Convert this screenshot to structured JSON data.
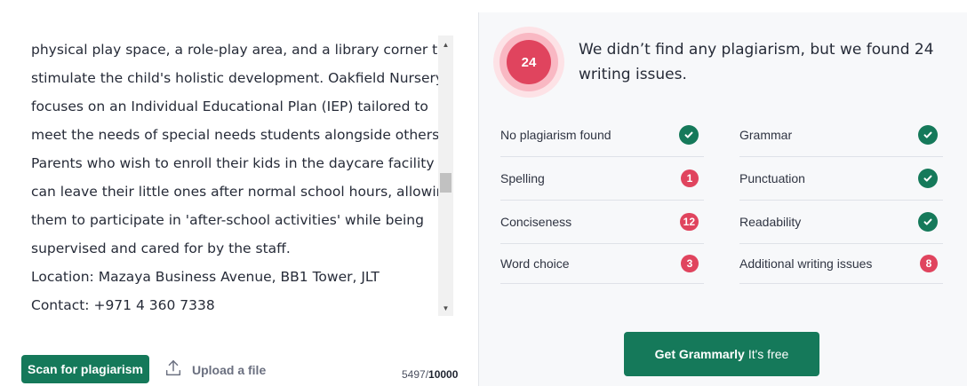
{
  "editor": {
    "lines": [
      "physical play space, a role-play area, and a library corner to",
      "stimulate the child's holistic development. Oakfield Nursery",
      "focuses on an Individual Educational Plan (IEP) tailored to",
      "meet the needs of special needs students alongside others.",
      "Parents who wish to enroll their kids in the daycare facility",
      "can leave their little ones after normal school hours, allowing",
      "them to participate in 'after-school activities' while being",
      "supervised and cared for by the staff.",
      "Location: Mazaya Business Avenue, BB1 Tower, JLT",
      "Contact: +971 4 360 7338"
    ],
    "scroll_up_icon": "▲",
    "scroll_down_icon": "▼"
  },
  "footer": {
    "scan_label": "Scan for plagiarism",
    "upload_label": "Upload a file",
    "char_count": "5497/",
    "char_limit": "10000"
  },
  "results": {
    "score": "24",
    "headline": "We didn’t find any plagiarism, but we found 24 writing issues.",
    "left_checks": [
      {
        "label": "No plagiarism found",
        "status": "ok",
        "count": ""
      },
      {
        "label": "Spelling",
        "status": "issue",
        "count": "1"
      },
      {
        "label": "Conciseness",
        "status": "issue",
        "count": "12"
      },
      {
        "label": "Word choice",
        "status": "issue",
        "count": "3"
      }
    ],
    "right_checks": [
      {
        "label": "Grammar",
        "status": "ok",
        "count": ""
      },
      {
        "label": "Punctuation",
        "status": "ok",
        "count": ""
      },
      {
        "label": "Readability",
        "status": "ok",
        "count": ""
      },
      {
        "label": "Additional writing issues",
        "status": "issue",
        "count": "8"
      }
    ],
    "cta_bold": "Get Grammarly",
    "cta_rest": "It's free"
  },
  "colors": {
    "brand_green": "#15795a",
    "issue_red": "#e0445e"
  }
}
